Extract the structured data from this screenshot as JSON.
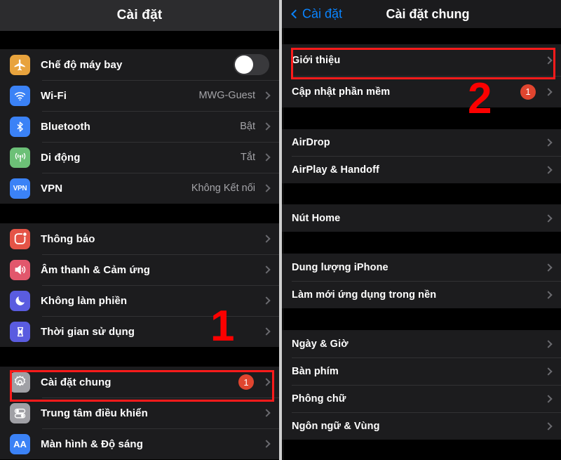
{
  "left_panel": {
    "nav": {
      "title": "Cài đặt"
    },
    "groups": [
      {
        "rows": [
          {
            "label": "Chế độ máy bay",
            "icon": "airplane-icon",
            "icon_color": "#e8a33d",
            "control": "toggle",
            "toggle_on": false
          },
          {
            "label": "Wi-Fi",
            "icon": "wifi-icon",
            "icon_color": "#3b82f6",
            "value": "MWG-Guest",
            "control": "chevron"
          },
          {
            "label": "Bluetooth",
            "icon": "bluetooth-icon",
            "icon_color": "#3b82f6",
            "value": "Bật",
            "control": "chevron"
          },
          {
            "label": "Di động",
            "icon": "cellular-icon",
            "icon_color": "#6cc077",
            "value": "Tắt",
            "control": "chevron"
          },
          {
            "label": "VPN",
            "icon": "vpn-icon",
            "icon_color": "#3b82f6",
            "value": "Không Kết nối",
            "control": "chevron"
          }
        ]
      },
      {
        "rows": [
          {
            "label": "Thông báo",
            "icon": "notifications-icon",
            "icon_color": "#e45447",
            "control": "chevron"
          },
          {
            "label": "Âm thanh & Cảm ứng",
            "icon": "sound-icon",
            "icon_color": "#e2576c",
            "control": "chevron"
          },
          {
            "label": "Không làm phiền",
            "icon": "moon-icon",
            "icon_color": "#5a5ce0",
            "control": "chevron"
          },
          {
            "label": "Thời gian sử dụng",
            "icon": "hourglass-icon",
            "icon_color": "#5a5ce0",
            "control": "chevron"
          }
        ]
      },
      {
        "rows": [
          {
            "label": "Cài đặt chung",
            "icon": "gear-icon",
            "icon_color": "#a0a0a5",
            "badge": "1",
            "control": "chevron",
            "highlighted": true
          },
          {
            "label": "Trung tâm điều khiển",
            "icon": "control-center-icon",
            "icon_color": "#a0a0a5",
            "control": "chevron"
          },
          {
            "label": "Màn hình & Độ sáng",
            "icon": "display-icon",
            "icon_color": "#3b82f6",
            "control": "chevron"
          }
        ]
      }
    ],
    "annotation": {
      "marker": "1"
    }
  },
  "right_panel": {
    "nav": {
      "back_label": "Cài đặt",
      "title": "Cài đặt chung",
      "back_icon": "chevron-left-icon",
      "accent": "#0a84ff"
    },
    "groups": [
      {
        "rows": [
          {
            "label": "Giới thiệu",
            "control": "chevron",
            "highlighted": true
          },
          {
            "label": "Cập nhật phần mềm",
            "badge": "1",
            "control": "chevron"
          }
        ]
      },
      {
        "rows": [
          {
            "label": "AirDrop",
            "control": "chevron"
          },
          {
            "label": "AirPlay & Handoff",
            "control": "chevron"
          }
        ]
      },
      {
        "rows": [
          {
            "label": "Nút Home",
            "control": "chevron"
          }
        ]
      },
      {
        "rows": [
          {
            "label": "Dung lượng iPhone",
            "control": "chevron"
          },
          {
            "label": "Làm mới ứng dụng trong nền",
            "control": "chevron"
          }
        ]
      },
      {
        "rows": [
          {
            "label": "Ngày & Giờ",
            "control": "chevron"
          },
          {
            "label": "Bàn phím",
            "control": "chevron"
          },
          {
            "label": "Phông chữ",
            "control": "chevron"
          },
          {
            "label": "Ngôn ngữ & Vùng",
            "control": "chevron"
          }
        ]
      }
    ],
    "annotation": {
      "marker": "2"
    }
  },
  "colors": {
    "highlight_box": "#ff1b1b",
    "badge": "#e0452f",
    "accent_blue": "#0a84ff",
    "row_bg": "#1c1c1e",
    "page_bg": "#000000"
  }
}
